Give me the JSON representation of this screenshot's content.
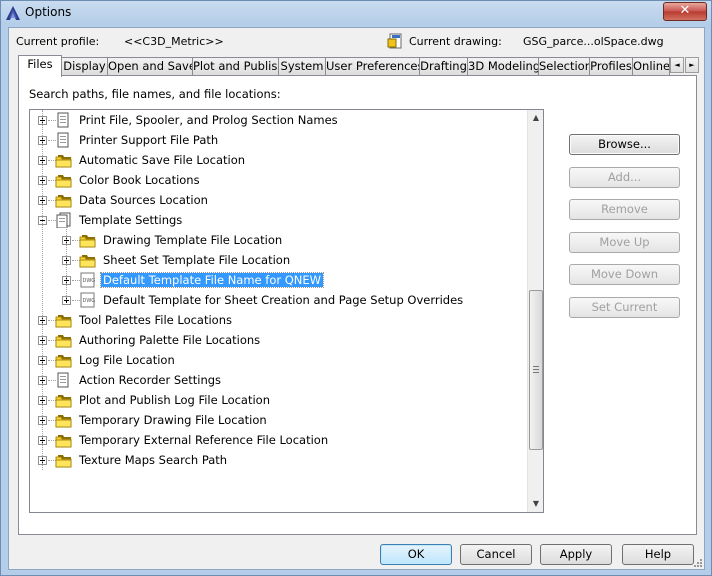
{
  "window": {
    "title": "Options",
    "close_symbol": "✕"
  },
  "header": {
    "current_profile_label": "Current profile:",
    "current_profile_value": "<<C3D_Metric>>",
    "current_drawing_label": "Current drawing:",
    "current_drawing_value": "GSG_parce...olSpace.dwg"
  },
  "tabs": [
    {
      "label": "Files",
      "active": true
    },
    {
      "label": "Display"
    },
    {
      "label": "Open and Save"
    },
    {
      "label": "Plot and Publish"
    },
    {
      "label": "System"
    },
    {
      "label": "User Preferences"
    },
    {
      "label": "Drafting"
    },
    {
      "label": "3D Modeling"
    },
    {
      "label": "Selection"
    },
    {
      "label": "Profiles"
    },
    {
      "label": "Online"
    }
  ],
  "tab_scroll": {
    "left": "◄",
    "right": "►"
  },
  "panel": {
    "label": "Search paths, file names, and file locations:"
  },
  "tree": {
    "items": [
      {
        "label": "Print File, Spooler, and Prolog Section Names",
        "icon": "document-icon",
        "level": 0
      },
      {
        "label": "Printer Support File Path",
        "icon": "document-icon",
        "level": 0
      },
      {
        "label": "Automatic Save File Location",
        "icon": "folder-icon",
        "level": 0
      },
      {
        "label": "Color Book Locations",
        "icon": "folder-icon",
        "level": 0
      },
      {
        "label": "Data Sources Location",
        "icon": "folder-icon",
        "level": 0
      },
      {
        "label": "Template Settings",
        "icon": "documents-icon",
        "level": 0,
        "expanded": true
      },
      {
        "label": "Drawing Template File Location",
        "icon": "folder-icon",
        "level": 1
      },
      {
        "label": "Sheet Set Template File Location",
        "icon": "folder-icon",
        "level": 1
      },
      {
        "label": "Default Template File Name for QNEW",
        "icon": "dwg-file-icon",
        "level": 1,
        "selected": true
      },
      {
        "label": "Default Template for Sheet Creation and Page Setup Overrides",
        "icon": "dwg-file-icon",
        "level": 1
      },
      {
        "label": "Tool Palettes File Locations",
        "icon": "folder-icon",
        "level": 0
      },
      {
        "label": "Authoring Palette File Locations",
        "icon": "folder-icon",
        "level": 0
      },
      {
        "label": "Log File Location",
        "icon": "folder-icon",
        "level": 0
      },
      {
        "label": "Action Recorder Settings",
        "icon": "document-icon",
        "level": 0
      },
      {
        "label": "Plot and Publish Log File Location",
        "icon": "folder-icon",
        "level": 0
      },
      {
        "label": "Temporary Drawing File Location",
        "icon": "folder-icon",
        "level": 0
      },
      {
        "label": "Temporary External Reference File Location",
        "icon": "folder-icon",
        "level": 0
      },
      {
        "label": "Texture Maps Search Path",
        "icon": "folder-icon",
        "level": 0
      }
    ]
  },
  "side_buttons": [
    {
      "label": "Browse...",
      "enabled": true
    },
    {
      "label": "Add...",
      "enabled": false
    },
    {
      "label": "Remove",
      "enabled": false
    },
    {
      "label": "Move Up",
      "enabled": false
    },
    {
      "label": "Move Down",
      "enabled": false
    },
    {
      "label": "Set Current",
      "enabled": false
    }
  ],
  "bottom_buttons": [
    {
      "label": "OK",
      "default": true
    },
    {
      "label": "Cancel"
    },
    {
      "label": "Apply"
    },
    {
      "label": "Help"
    }
  ]
}
